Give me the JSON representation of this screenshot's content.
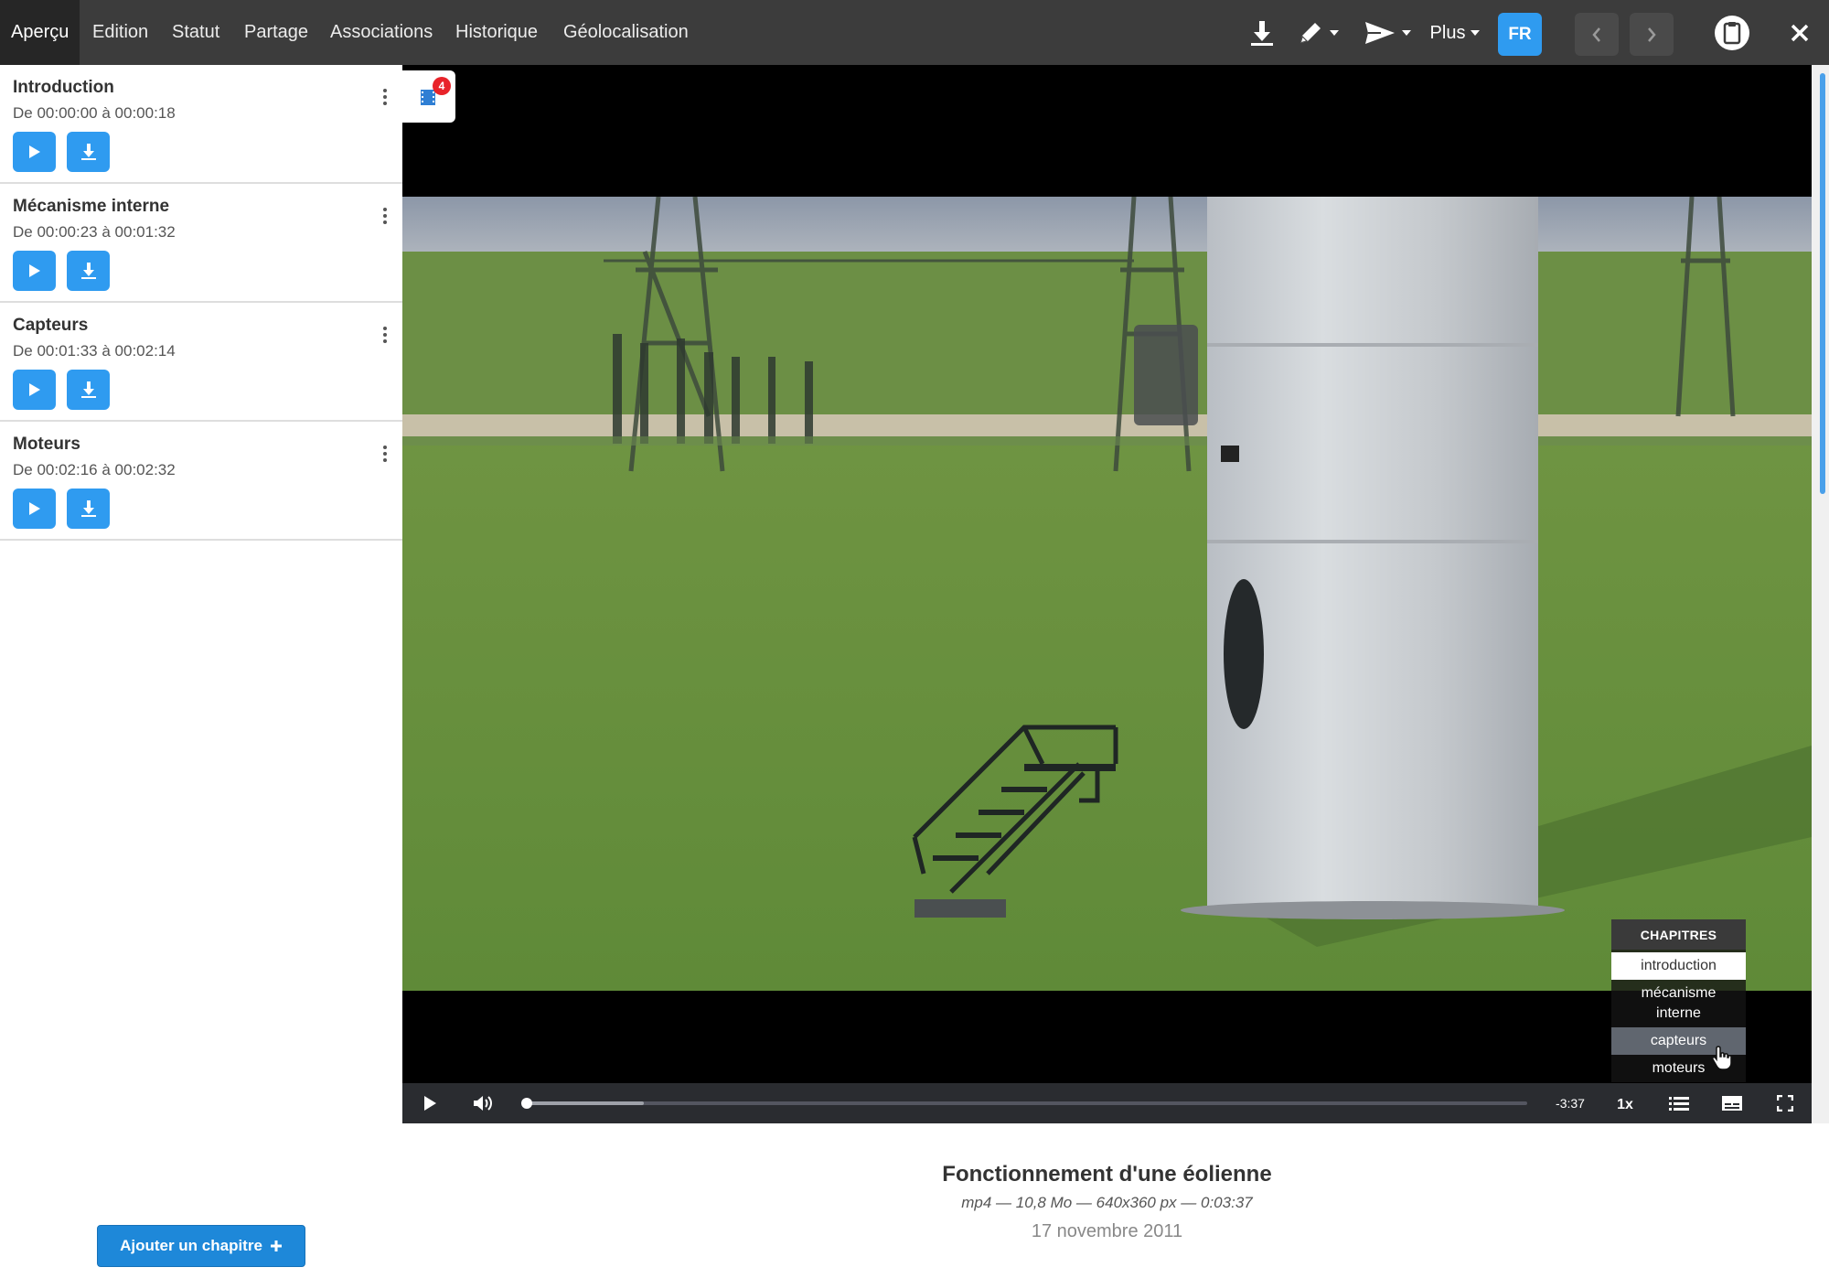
{
  "topbar": {
    "tabs": [
      {
        "label": "Aperçu",
        "active": true
      },
      {
        "label": "Edition",
        "active": false
      },
      {
        "label": "Statut",
        "active": false
      },
      {
        "label": "Partage",
        "active": false
      },
      {
        "label": "Associations",
        "active": false
      },
      {
        "label": "Historique",
        "active": false
      },
      {
        "label": "Géolocalisation",
        "active": false
      }
    ],
    "more_label": "Plus",
    "language": "FR",
    "icons": [
      "download-icon",
      "pencil-icon",
      "send-icon",
      "chevron-left-icon",
      "chevron-right-icon",
      "clipboard-icon",
      "close-icon"
    ]
  },
  "sidebar": {
    "chapters": [
      {
        "title": "Introduction",
        "range": "De 00:00:00 à 00:00:18"
      },
      {
        "title": "Mécanisme interne",
        "range": "De 00:00:23 à 00:01:32"
      },
      {
        "title": "Capteurs",
        "range": "De 00:01:33 à 00:02:14"
      },
      {
        "title": "Moteurs",
        "range": "De 00:02:16 à 00:02:32"
      }
    ],
    "add_chapter_label": "Ajouter un chapitre"
  },
  "player": {
    "chapters_badge_count": "4",
    "chapters_menu": {
      "header": "CHAPITRES",
      "items": [
        "introduction",
        "mécanisme interne",
        "capteurs",
        "moteurs"
      ],
      "selected_index": 0,
      "hover_index": 2
    },
    "remaining_time": "-3:37",
    "playback_rate": "1x",
    "progress_played": 0.0,
    "progress_buffered": 0.12
  },
  "media": {
    "title": "Fonctionnement d'une éolienne",
    "meta": "mp4 — 10,8 Mo — 640x360 px — 0:03:37",
    "date": "17 novembre 2011"
  },
  "colors": {
    "topbar_bg": "#3c3c3c",
    "accent_blue": "#2f9bf0",
    "badge_red": "#e8232a"
  }
}
